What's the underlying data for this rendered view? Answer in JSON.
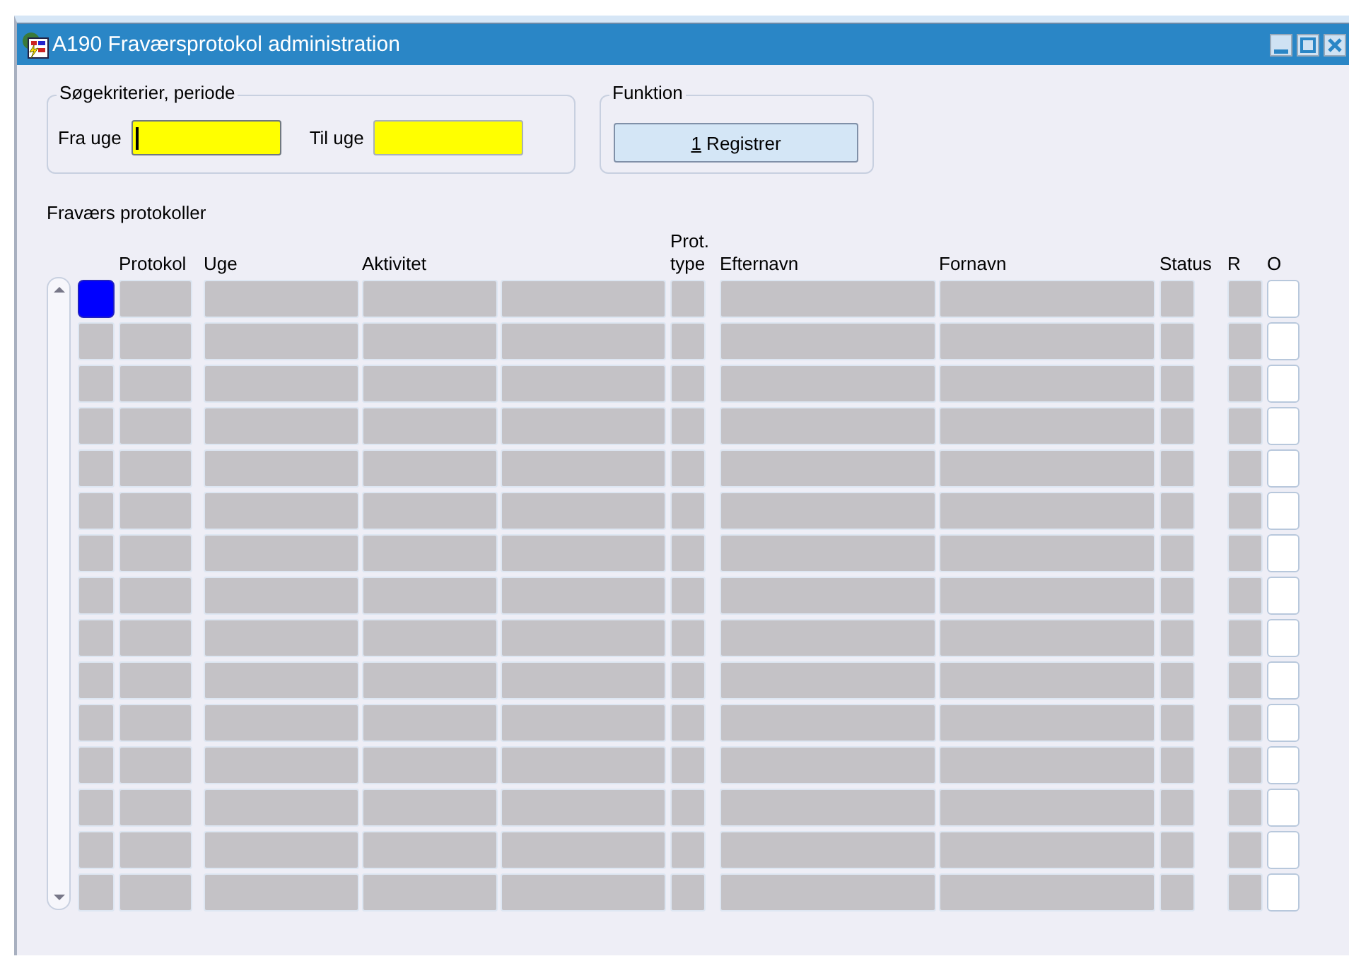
{
  "window": {
    "title": "A190 Fraværsprotokol administration"
  },
  "search_criteria": {
    "title": "Søgekriterier, periode",
    "fields": [
      {
        "label": "Fra uge",
        "focused": true
      },
      {
        "label": "Til uge",
        "focused": false
      }
    ]
  },
  "function": {
    "title": "Funktion",
    "button": {
      "shortcut": "1",
      "label": "Registrer"
    }
  },
  "table": {
    "title": "Fraværs protokoller",
    "columns": [
      {
        "kind": "indicator"
      },
      {
        "label": "Protokol"
      },
      {
        "label": "Uge"
      },
      {
        "label": "Aktivitet"
      },
      {
        "kind": "field"
      },
      {
        "label": "Prot.\ntype"
      },
      {
        "label": "Efternavn"
      },
      {
        "label": "Fornavn"
      },
      {
        "label": "Status"
      },
      {
        "label": "R"
      },
      {
        "label": "O",
        "kind": "checkbox"
      }
    ],
    "rows": [
      {
        "selected": true,
        "checked": false
      },
      {
        "selected": false,
        "checked": false
      },
      {
        "selected": false,
        "checked": false
      },
      {
        "selected": false,
        "checked": false
      },
      {
        "selected": false,
        "checked": false
      },
      {
        "selected": false,
        "checked": false
      },
      {
        "selected": false,
        "checked": false
      },
      {
        "selected": false,
        "checked": false
      },
      {
        "selected": false,
        "checked": false
      },
      {
        "selected": false,
        "checked": false
      },
      {
        "selected": false,
        "checked": false
      },
      {
        "selected": false,
        "checked": false
      },
      {
        "selected": false,
        "checked": false
      },
      {
        "selected": false,
        "checked": false
      },
      {
        "selected": false,
        "checked": false
      }
    ]
  }
}
